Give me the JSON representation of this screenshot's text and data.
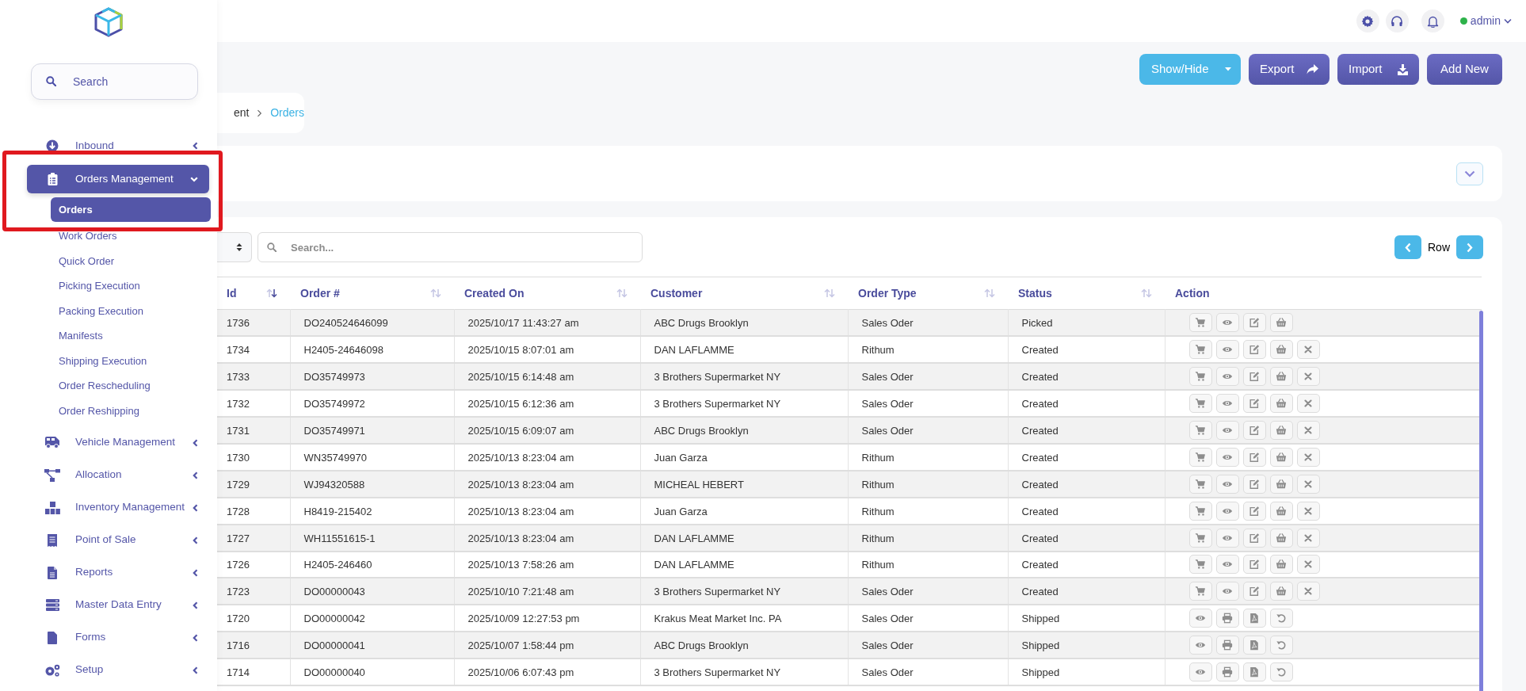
{
  "sidebar": {
    "search": {
      "placeholder": "Search"
    },
    "items": [
      {
        "label": "Inbound",
        "selected": false,
        "expanded": false
      },
      {
        "label": "Orders Management",
        "selected": true,
        "expanded": true,
        "children": [
          {
            "label": "Orders",
            "selected": true
          },
          {
            "label": "Work Orders",
            "selected": false
          },
          {
            "label": "Quick Order",
            "selected": false
          },
          {
            "label": "Picking Execution",
            "selected": false
          },
          {
            "label": "Packing Execution",
            "selected": false
          },
          {
            "label": "Manifests",
            "selected": false
          },
          {
            "label": "Shipping Execution",
            "selected": false
          },
          {
            "label": "Order Rescheduling",
            "selected": false
          },
          {
            "label": "Order Reshipping",
            "selected": false
          }
        ]
      },
      {
        "label": "Vehicle Management",
        "selected": false,
        "expanded": false
      },
      {
        "label": "Allocation",
        "selected": false,
        "expanded": false
      },
      {
        "label": "Inventory Management",
        "selected": false,
        "expanded": false
      },
      {
        "label": "Point of Sale",
        "selected": false,
        "expanded": false
      },
      {
        "label": "Reports",
        "selected": false,
        "expanded": false
      },
      {
        "label": "Master Data Entry",
        "selected": false,
        "expanded": false
      },
      {
        "label": "Forms",
        "selected": false,
        "expanded": false
      },
      {
        "label": "Setup",
        "selected": false,
        "expanded": false
      }
    ]
  },
  "header": {
    "user": "admin"
  },
  "toolbar": [
    {
      "label": "Show/Hide",
      "kind": "dropdown"
    },
    {
      "label": "Export",
      "kind": "export"
    },
    {
      "label": "Import",
      "kind": "import"
    },
    {
      "label": "Add New",
      "kind": "add"
    }
  ],
  "breadcrumb": [
    "ent",
    "Orders"
  ],
  "table_controls": {
    "search": {
      "placeholder": "Search..."
    },
    "pager_label": "Row"
  },
  "table": {
    "columns": [
      {
        "label": "Id",
        "kind": "sorted"
      },
      {
        "label": "Order #",
        "kind": "sortable"
      },
      {
        "label": "Created On",
        "kind": "sortable"
      },
      {
        "label": "Customer",
        "kind": "sortable"
      },
      {
        "label": "Order Type",
        "kind": "sortable"
      },
      {
        "label": "Status",
        "kind": "sortable"
      },
      {
        "label": "Action",
        "kind": "plain"
      }
    ],
    "rows": [
      {
        "cells": [
          "1736",
          "DO240524646099",
          "2025/10/17 11:43:27 am",
          "ABC Drugs Brooklyn",
          "Sales Oder",
          "Picked"
        ],
        "kind": "picked"
      },
      {
        "cells": [
          "1734",
          "H2405-24646098",
          "2025/10/15 8:07:01 am",
          "DAN LAFLAMME",
          "Rithum",
          "Created"
        ],
        "kind": "open"
      },
      {
        "cells": [
          "1733",
          "DO35749973",
          "2025/10/15 6:14:48 am",
          "3 Brothers Supermarket NY",
          "Sales Oder",
          "Created"
        ],
        "kind": "open"
      },
      {
        "cells": [
          "1732",
          "DO35749972",
          "2025/10/15 6:12:36 am",
          "3 Brothers Supermarket NY",
          "Sales Oder",
          "Created"
        ],
        "kind": "open"
      },
      {
        "cells": [
          "1731",
          "DO35749971",
          "2025/10/15 6:09:07 am",
          "ABC Drugs Brooklyn",
          "Sales Oder",
          "Created"
        ],
        "kind": "open"
      },
      {
        "cells": [
          "1730",
          "WN35749970",
          "2025/10/13 8:23:04 am",
          "Juan Garza",
          "Rithum",
          "Created"
        ],
        "kind": "open"
      },
      {
        "cells": [
          "1729",
          "WJ94320588",
          "2025/10/13 8:23:04 am",
          "MICHEAL HEBERT",
          "Rithum",
          "Created"
        ],
        "kind": "open"
      },
      {
        "cells": [
          "1728",
          "H8419-215402",
          "2025/10/13 8:23:04 am",
          "Juan Garza",
          "Rithum",
          "Created"
        ],
        "kind": "open"
      },
      {
        "cells": [
          "1727",
          "WH11551615-1",
          "2025/10/13 8:23:04 am",
          "DAN LAFLAMME",
          "Rithum",
          "Created"
        ],
        "kind": "open"
      },
      {
        "cells": [
          "1726",
          "H2405-246460",
          "2025/10/13 7:58:26 am",
          "DAN LAFLAMME",
          "Rithum",
          "Created"
        ],
        "kind": "open"
      },
      {
        "cells": [
          "1723",
          "DO00000043",
          "2025/10/10 7:21:48 am",
          "3 Brothers Supermarket NY",
          "Sales Oder",
          "Created"
        ],
        "kind": "open"
      },
      {
        "cells": [
          "1720",
          "DO00000042",
          "2025/10/09 12:27:53 pm",
          "Krakus Meat Market Inc. PA",
          "Sales Oder",
          "Shipped"
        ],
        "kind": "shipped"
      },
      {
        "cells": [
          "1716",
          "DO00000041",
          "2025/10/07 1:58:44 pm",
          "ABC Drugs Brooklyn",
          "Sales Oder",
          "Shipped"
        ],
        "kind": "shipped"
      },
      {
        "cells": [
          "1714",
          "DO00000040",
          "2025/10/06 6:07:43 pm",
          "3 Brothers Supermarket NY",
          "Sales Oder",
          "Shipped"
        ],
        "kind": "shipped"
      }
    ]
  }
}
